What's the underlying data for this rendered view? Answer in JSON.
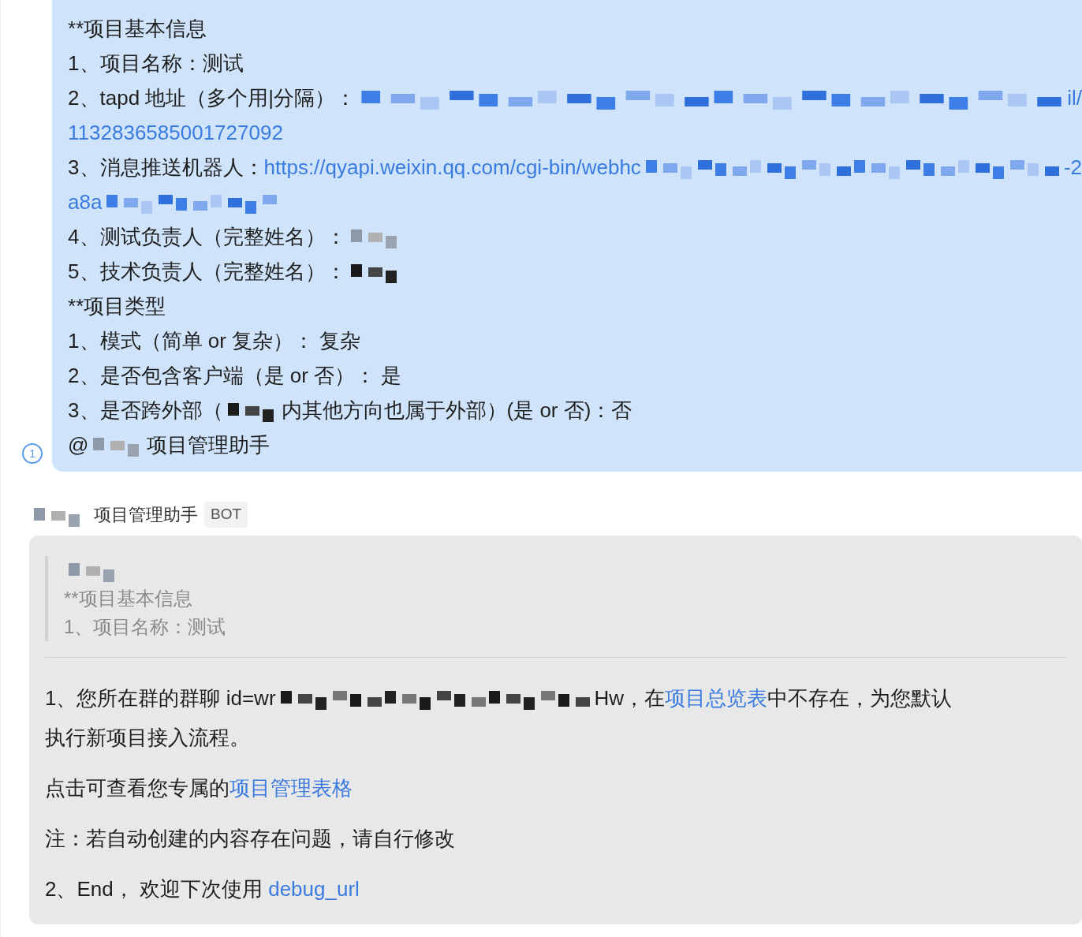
{
  "sent_message": {
    "lines": [
      [
        {
          "kind": "text",
          "text": "**项目基本信息"
        }
      ],
      [
        {
          "kind": "text",
          "text": "1、项目名称：测试"
        }
      ],
      [
        {
          "kind": "text",
          "text": "2、tapd 地址（多个用|分隔）："
        },
        {
          "kind": "masked-link"
        },
        {
          "kind": "link",
          "text": "il/"
        }
      ],
      [
        {
          "kind": "link",
          "text": "1132836585001727092"
        }
      ],
      [
        {
          "kind": "text",
          "text": "3、消息推送机器人："
        },
        {
          "kind": "link",
          "text": "https://qyapi.weixin.qq.com/cgi-bin/webhc"
        },
        {
          "kind": "masked-link"
        },
        {
          "kind": "link",
          "text": "-2"
        }
      ],
      [
        {
          "kind": "link",
          "text": "a8a"
        },
        {
          "kind": "masked-tail"
        }
      ],
      [
        {
          "kind": "text",
          "text": "4、测试负责人（完整姓名）："
        },
        {
          "kind": "masked-name"
        }
      ],
      [
        {
          "kind": "text",
          "text": "5、技术负责人（完整姓名）："
        },
        {
          "kind": "masked-dark"
        }
      ],
      [
        {
          "kind": "text",
          "text": "**项目类型"
        }
      ],
      [
        {
          "kind": "text",
          "text": "1、模式（简单 or 复杂）： 复杂"
        }
      ],
      [
        {
          "kind": "text",
          "text": "2、是否包含客户端（是 or 否）： 是"
        }
      ],
      [
        {
          "kind": "text",
          "text": "3、是否跨外部（"
        },
        {
          "kind": "masked-dark"
        },
        {
          "kind": "text",
          "text": "内其他方向也属于外部）(是 or 否)：否"
        }
      ],
      [
        {
          "kind": "text",
          "text": "@"
        },
        {
          "kind": "masked-name"
        },
        {
          "kind": "text",
          "text": "项目管理助手"
        }
      ]
    ],
    "read_count": "1"
  },
  "bot_message": {
    "sender": [
      {
        "kind": "masked-name"
      },
      {
        "kind": "text",
        "text": "项目管理助手"
      }
    ],
    "badge": "BOT",
    "quote": {
      "lines": [
        [
          {
            "kind": "masked-name"
          }
        ],
        [
          {
            "kind": "text",
            "text": "**项目基本信息"
          }
        ],
        [
          {
            "kind": "text",
            "text": "1、项目名称：测试"
          }
        ]
      ]
    },
    "paragraphs": [
      [
        [
          {
            "kind": "text",
            "text": "1、您所在群的群聊 id=wr"
          },
          {
            "kind": "masked-id"
          },
          {
            "kind": "text",
            "text": "Hw，在"
          },
          {
            "kind": "link",
            "text": "项目总览表"
          },
          {
            "kind": "text",
            "text": "中不存在，为您默认"
          }
        ],
        [
          {
            "kind": "text",
            "text": "执行新项目接入流程。"
          }
        ]
      ],
      [
        [
          {
            "kind": "text",
            "text": "点击可查看您专属的"
          },
          {
            "kind": "link",
            "text": "项目管理表格"
          }
        ]
      ],
      [
        [
          {
            "kind": "text",
            "text": "注：若自动创建的内容存在问题，请自行修改"
          }
        ]
      ],
      [
        [
          {
            "kind": "text",
            "text": "2、End， 欢迎下次使用 "
          },
          {
            "kind": "link",
            "text": "debug_url"
          }
        ]
      ]
    ]
  }
}
